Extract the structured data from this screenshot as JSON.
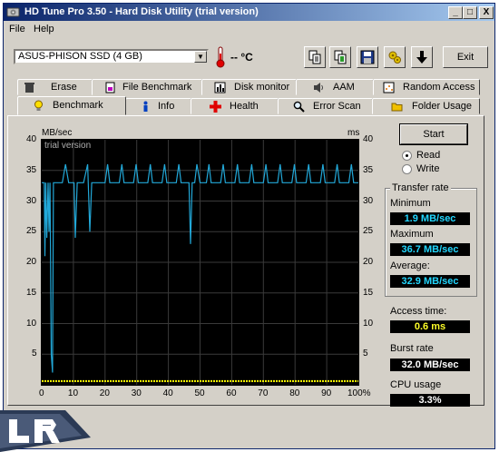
{
  "window": {
    "title": "HD Tune Pro 3.50 - Hard Disk Utility (trial version)",
    "controls": {
      "minimize": "_",
      "maximize": "□",
      "close": "X"
    }
  },
  "menu": {
    "file": "File",
    "help": "Help"
  },
  "toolbar": {
    "drive": "ASUS-PHISON SSD (4 GB)",
    "temperature": "-- °C",
    "exit": "Exit",
    "icons": [
      "copy-text-icon",
      "copy-screen-icon",
      "save-icon",
      "options-icon",
      "download-arrow-icon"
    ]
  },
  "tabs_row1": [
    {
      "label": "Erase",
      "icon": "trash-icon"
    },
    {
      "label": "File Benchmark",
      "icon": "file-benchmark-icon"
    },
    {
      "label": "Disk monitor",
      "icon": "disk-monitor-icon"
    },
    {
      "label": "AAM",
      "icon": "speaker-icon"
    },
    {
      "label": "Random Access",
      "icon": "random-access-icon"
    }
  ],
  "tabs_row2": [
    {
      "label": "Benchmark",
      "icon": "bulb-icon",
      "active": true
    },
    {
      "label": "Info",
      "icon": "info-icon"
    },
    {
      "label": "Health",
      "icon": "health-cross-icon"
    },
    {
      "label": "Error Scan",
      "icon": "magnifier-icon"
    },
    {
      "label": "Folder Usage",
      "icon": "folder-icon"
    }
  ],
  "benchmark": {
    "start": "Start",
    "read": "Read",
    "write": "Write",
    "mode_selected": "Read",
    "transfer_rate_title": "Transfer rate",
    "minimum_label": "Minimum",
    "minimum": "1.9 MB/sec",
    "maximum_label": "Maximum",
    "maximum": "36.7 MB/sec",
    "average_label": "Average:",
    "average": "32.9 MB/sec",
    "access_time_label": "Access time:",
    "access_time": "0.6 ms",
    "burst_rate_label": "Burst rate",
    "burst_rate": "32.0 MB/sec",
    "cpu_usage_label": "CPU usage",
    "cpu_usage": "3.3%",
    "colors": {
      "transfer": "#22a8d8",
      "access": "#ffff00",
      "stat_cyan": "#22d7ff",
      "stat_yellow": "#ffff28"
    }
  },
  "chart_data": {
    "type": "line",
    "ylabel": "MB/sec",
    "y2label": "ms",
    "watermark": "trial version",
    "ylim": [
      0,
      40
    ],
    "y2lim": [
      0,
      40
    ],
    "xlim": [
      0,
      100
    ],
    "yticks": [
      "40",
      "35",
      "30",
      "25",
      "20",
      "15",
      "10",
      "5"
    ],
    "y2ticks": [
      "40",
      "35",
      "30",
      "25",
      "20",
      "15",
      "10",
      "5"
    ],
    "xticks": [
      "0",
      "10",
      "20",
      "30",
      "40",
      "50",
      "60",
      "70",
      "80",
      "90",
      "100%"
    ],
    "grid": true,
    "series": [
      {
        "values_x": [
          0,
          0.8,
          1.0,
          1.3,
          1.6,
          2.0,
          2.3,
          2.6,
          3.0,
          3.4,
          3.7,
          4.0,
          4.4,
          4.8,
          5.5,
          6.5,
          7.5,
          8.5,
          9.5,
          10.2,
          10.6,
          11.2,
          12.0,
          13.2,
          14.5,
          15.2,
          15.8,
          16.6,
          18.0,
          20.0,
          20.8,
          21.5,
          22.5,
          24.5,
          25.3,
          26.0,
          27.0,
          29.0,
          29.8,
          30.5,
          31.5,
          33.5,
          34.3,
          35.0,
          36.0,
          38.0,
          38.8,
          39.5,
          40.5,
          42.5,
          43.3,
          44.0,
          45.0,
          46.5,
          47.0,
          47.5,
          48.3,
          49.0,
          50.0,
          52.0,
          52.8,
          53.5,
          54.5,
          56.5,
          57.3,
          58.0,
          59.0,
          61.0,
          61.8,
          62.5,
          63.5,
          65.5,
          66.3,
          67.0,
          68.0,
          70.0,
          70.8,
          71.5,
          72.5,
          74.5,
          75.3,
          76.0,
          77.0,
          79.0,
          79.8,
          80.5,
          81.5,
          83.5,
          84.3,
          85.0,
          86.0,
          88.0,
          88.8,
          89.5,
          90.5,
          92.5,
          93.3,
          94.0,
          95.0,
          97.0,
          97.8,
          98.5,
          100
        ],
        "values_y": [
          33,
          33,
          21,
          33,
          24,
          33,
          25,
          33,
          5,
          2,
          33,
          33,
          33,
          33,
          33,
          33,
          36,
          33,
          33,
          33,
          24,
          33,
          33,
          33,
          36,
          25,
          33,
          33,
          33,
          33,
          36,
          33,
          33,
          33,
          36,
          33,
          33,
          33,
          36,
          33,
          33,
          33,
          36,
          33,
          33,
          33,
          36,
          33,
          33,
          33,
          36,
          33,
          33,
          33,
          23,
          33,
          33,
          36,
          33,
          33,
          36,
          33,
          33,
          33,
          36,
          33,
          33,
          33,
          36,
          33,
          33,
          33,
          36,
          33,
          33,
          33,
          36,
          33,
          33,
          33,
          36,
          33,
          33,
          33,
          36,
          33,
          33,
          33,
          36,
          33,
          33,
          33,
          36,
          33,
          33,
          33,
          36,
          33,
          33,
          33,
          36,
          33,
          33
        ],
        "color": "#22a8d8"
      },
      {
        "values_x": [
          0,
          10,
          20,
          30,
          40,
          50,
          60,
          70,
          80,
          90,
          100
        ],
        "values_y": [
          0.6,
          0.6,
          0.6,
          0.6,
          0.6,
          0.6,
          0.6,
          0.6,
          0.6,
          0.6,
          0.6
        ],
        "color": "#ffff00"
      }
    ]
  },
  "branding": {
    "watermark": "LR"
  }
}
